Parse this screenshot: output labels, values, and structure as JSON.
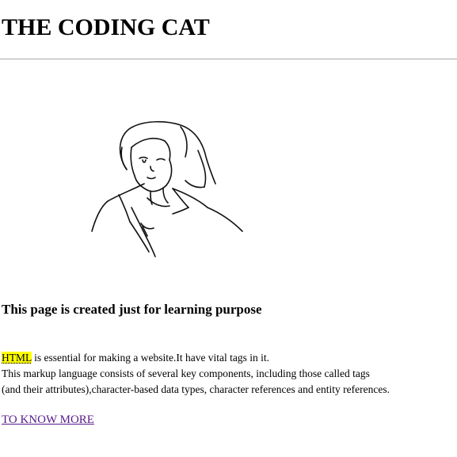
{
  "header": {
    "title": "THE CODING CAT"
  },
  "illustration": {
    "icon": "line-drawing-girl-illustration"
  },
  "content": {
    "heading": "This page is created just for learning purpose",
    "abbr": "HTML",
    "line1_rest": " is essential for making a website.It have vital tags in it.",
    "line2": "This markup language consists of several key components, including those called tags",
    "line3": "(and their attributes),character-based data types, character references and entity references."
  },
  "link": {
    "label": "TO KNOW MORE"
  },
  "colors": {
    "highlight": "#ffff00",
    "visited_link": "#551a8b",
    "divider": "#a8a8a8"
  }
}
